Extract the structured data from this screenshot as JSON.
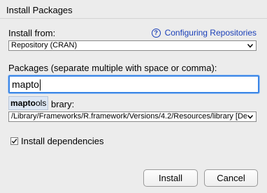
{
  "window": {
    "title": "Install Packages"
  },
  "install_from": {
    "label": "Install from:",
    "help_link": "Configuring Repositories",
    "help_icon": "question-icon",
    "selected": "Repository (CRAN)"
  },
  "packages": {
    "label": "Packages (separate multiple with space or comma):",
    "value": "mapto",
    "autocomplete": {
      "match": "mapto",
      "rest": "ols"
    }
  },
  "library": {
    "label_visible": "brary:",
    "selected": "/Library/Frameworks/R.framework/Versions/4.2/Resources/library [De"
  },
  "dependencies": {
    "label": "Install dependencies",
    "checked": true
  },
  "buttons": {
    "install": "Install",
    "cancel": "Cancel"
  },
  "colors": {
    "link": "#1a3fb8",
    "focus": "#3b86e6",
    "background": "#ececec"
  }
}
